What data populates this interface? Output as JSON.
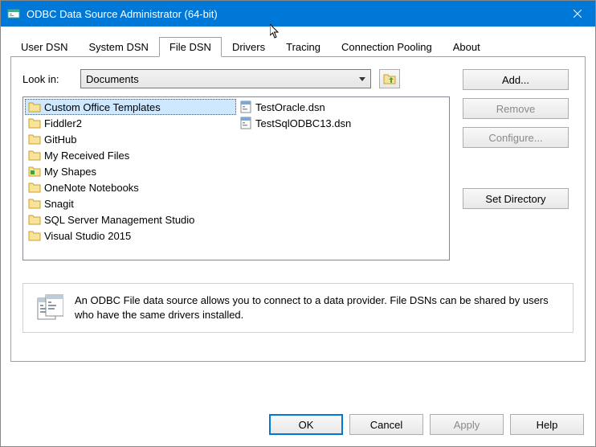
{
  "window": {
    "title": "ODBC Data Source Administrator (64-bit)"
  },
  "tabs": [
    {
      "label": "User DSN"
    },
    {
      "label": "System DSN"
    },
    {
      "label": "File DSN"
    },
    {
      "label": "Drivers"
    },
    {
      "label": "Tracing"
    },
    {
      "label": "Connection Pooling"
    },
    {
      "label": "About"
    }
  ],
  "lookin": {
    "label": "Look in:",
    "value": "Documents"
  },
  "files": {
    "col1": [
      {
        "name": "Custom Office Templates",
        "type": "folder",
        "selected": true
      },
      {
        "name": "Fiddler2",
        "type": "folder"
      },
      {
        "name": "GitHub",
        "type": "folder"
      },
      {
        "name": "My Received Files",
        "type": "folder"
      },
      {
        "name": "My Shapes",
        "type": "shapes"
      },
      {
        "name": "OneNote Notebooks",
        "type": "folder"
      },
      {
        "name": "Snagit",
        "type": "folder"
      },
      {
        "name": "SQL Server Management Studio",
        "type": "folder"
      },
      {
        "name": "Visual Studio 2015",
        "type": "folder"
      }
    ],
    "col2": [
      {
        "name": "TestOracle.dsn",
        "type": "dsn"
      },
      {
        "name": "TestSqlODBC13.dsn",
        "type": "dsn"
      }
    ]
  },
  "buttons": {
    "add": "Add...",
    "remove": "Remove",
    "configure": "Configure...",
    "setdir": "Set Directory",
    "ok": "OK",
    "cancel": "Cancel",
    "apply": "Apply",
    "help": "Help"
  },
  "info": "An ODBC File data source allows you to connect to a data provider.  File DSNs can be shared by users who have the same drivers installed."
}
